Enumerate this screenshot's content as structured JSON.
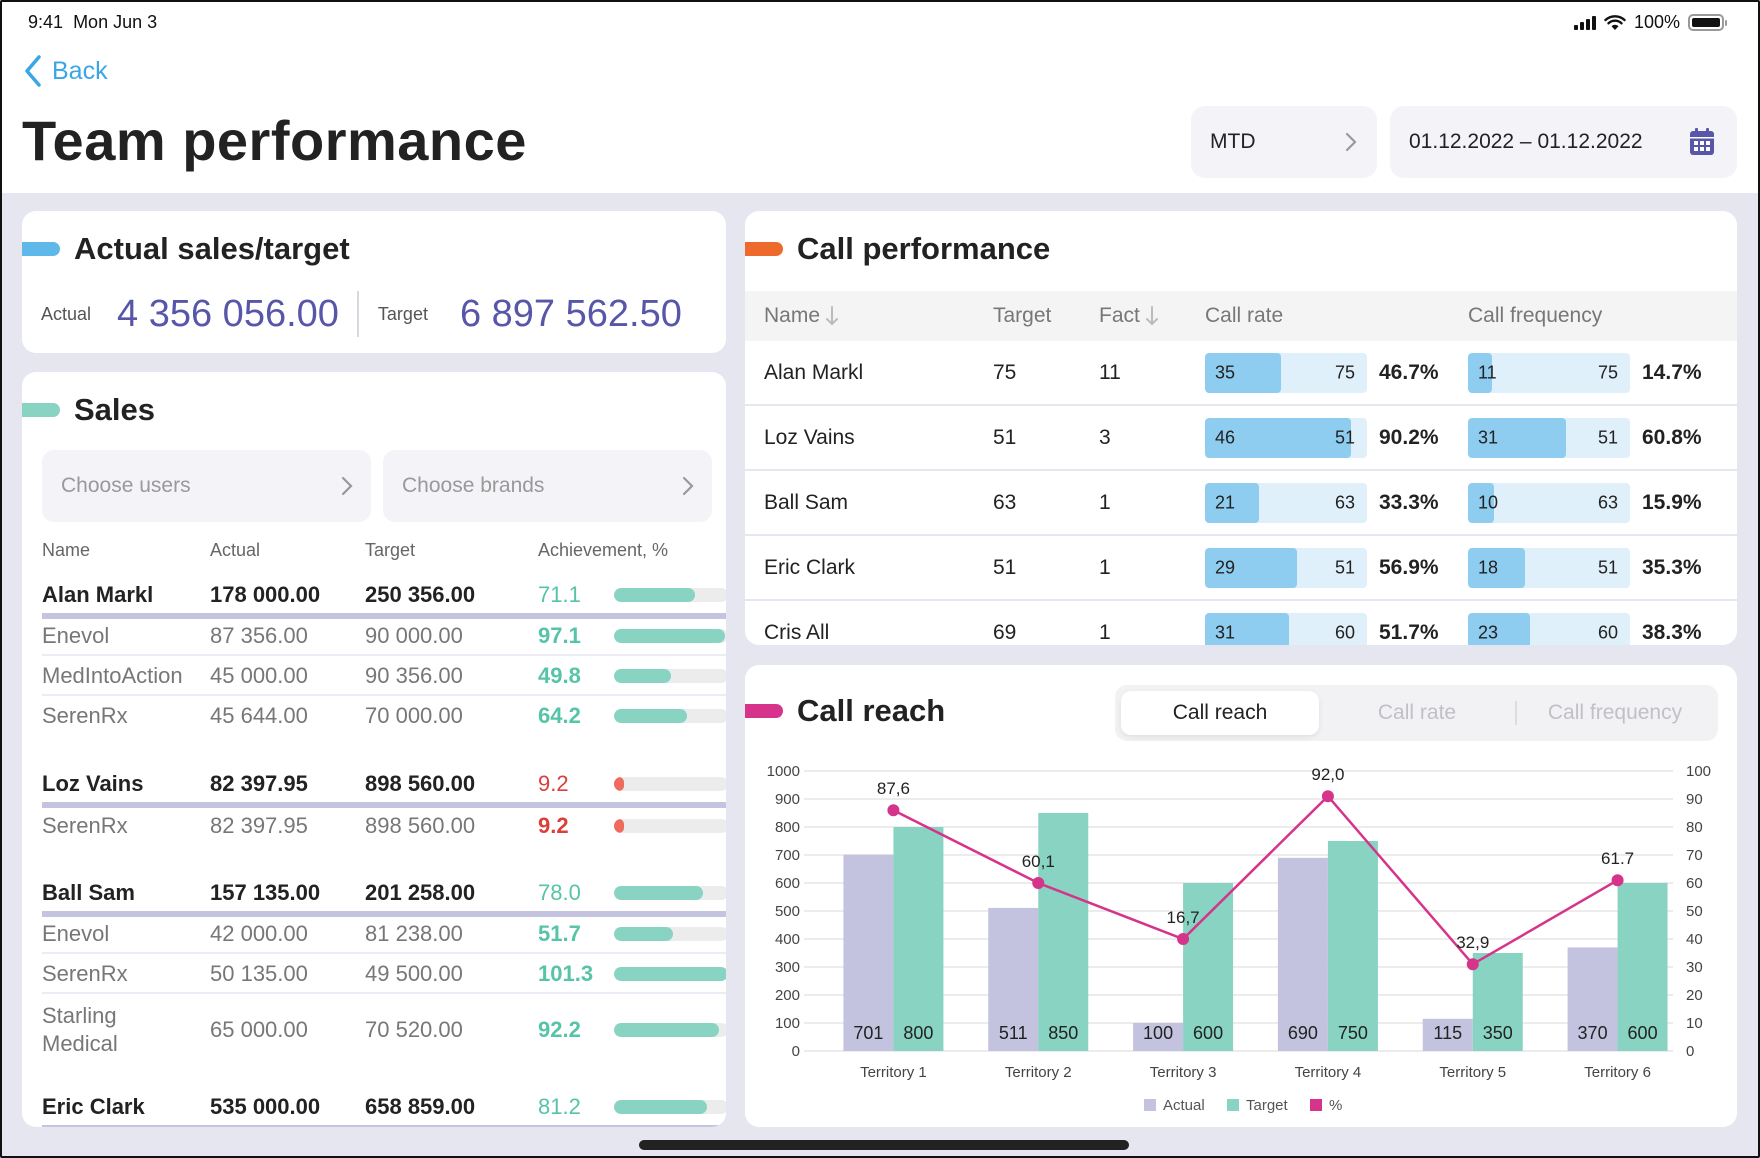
{
  "status_bar": {
    "time": "9:41",
    "date": "Mon Jun 3",
    "battery": "100%"
  },
  "nav": {
    "back_label": "Back"
  },
  "header": {
    "title": "Team performance",
    "period": "MTD",
    "date_range": "01.12.2022 – 01.12.2022"
  },
  "actual_sales": {
    "title": "Actual sales/target",
    "accent": "#5fb8ea",
    "actual_label": "Actual",
    "actual_value": "4 356 056.00",
    "target_label": "Target",
    "target_value": "6 897 562.50"
  },
  "sales": {
    "title": "Sales",
    "accent": "#88d3c2",
    "filters": {
      "users_placeholder": "Choose users",
      "brands_placeholder": "Choose brands"
    },
    "columns": [
      "Name",
      "Actual",
      "Target",
      "Achievement, %"
    ],
    "rows": [
      {
        "type": "parent",
        "name": "Alan Markl",
        "actual": "178 000.00",
        "target": "250 356.00",
        "achievement": "71.1",
        "pct": 71.1,
        "status": "good"
      },
      {
        "type": "child",
        "name": "Enevol",
        "actual": "87 356.00",
        "target": "90 000.00",
        "achievement": "97.1",
        "pct": 97.1,
        "status": "good"
      },
      {
        "type": "child",
        "name": "MedIntoAction",
        "actual": "45 000.00",
        "target": "90 356.00",
        "achievement": "49.8",
        "pct": 49.8,
        "status": "good"
      },
      {
        "type": "child",
        "name": "SerenRx",
        "actual": "45 644.00",
        "target": "70 000.00",
        "achievement": "64.2",
        "pct": 64.2,
        "status": "good"
      },
      {
        "type": "parent",
        "name": "Loz Vains",
        "actual": "82 397.95",
        "target": "898 560.00",
        "achievement": "9.2",
        "pct": 9.2,
        "status": "bad"
      },
      {
        "type": "child",
        "name": "SerenRx",
        "actual": "82 397.95",
        "target": "898 560.00",
        "achievement": "9.2",
        "pct": 9.2,
        "status": "bad"
      },
      {
        "type": "parent",
        "name": "Ball Sam",
        "actual": "157 135.00",
        "target": "201 258.00",
        "achievement": "78.0",
        "pct": 78.0,
        "status": "good"
      },
      {
        "type": "child",
        "name": "Enevol",
        "actual": "42 000.00",
        "target": "81 238.00",
        "achievement": "51.7",
        "pct": 51.7,
        "status": "good"
      },
      {
        "type": "child",
        "name": "SerenRx",
        "actual": "50 135.00",
        "target": "49 500.00",
        "achievement": "101.3",
        "pct": 101.3,
        "status": "good"
      },
      {
        "type": "child",
        "name": "Starling Medical",
        "actual": "65 000.00",
        "target": "70 520.00",
        "achievement": "92.2",
        "pct": 92.2,
        "status": "good"
      },
      {
        "type": "parent",
        "name": "Eric Clark",
        "actual": "535 000.00",
        "target": "658 859.00",
        "achievement": "81.2",
        "pct": 81.2,
        "status": "good"
      }
    ],
    "colors": {
      "good": "#57c3a8",
      "good_bar": "#88d3c2",
      "bad": "#d9403a",
      "bad_bar": "#ee6b5e"
    }
  },
  "call_performance": {
    "title": "Call performance",
    "accent": "#ee6a2c",
    "columns": [
      "Name",
      "Target",
      "Fact",
      "Call rate",
      "Call frequency"
    ],
    "rows": [
      {
        "name": "Alan Markl",
        "target": "75",
        "fact": "11",
        "rate_value": 35,
        "rate_max": 75,
        "rate_pct": "46.7%",
        "freq_value": 11,
        "freq_max": 75,
        "freq_pct": "14.7%"
      },
      {
        "name": "Loz Vains",
        "target": "51",
        "fact": "3",
        "rate_value": 46,
        "rate_max": 51,
        "rate_pct": "90.2%",
        "freq_value": 31,
        "freq_max": 51,
        "freq_pct": "60.8%"
      },
      {
        "name": "Ball Sam",
        "target": "63",
        "fact": "1",
        "rate_value": 21,
        "rate_max": 63,
        "rate_pct": "33.3%",
        "freq_value": 10,
        "freq_max": 63,
        "freq_pct": "15.9%"
      },
      {
        "name": "Eric Clark",
        "target": "51",
        "fact": "1",
        "rate_value": 29,
        "rate_max": 51,
        "rate_pct": "56.9%",
        "freq_value": 18,
        "freq_max": 51,
        "freq_pct": "35.3%"
      },
      {
        "name": "Cris All",
        "target": "69",
        "fact": "1",
        "rate_value": 31,
        "rate_max": 60,
        "rate_pct": "51.7%",
        "freq_value": 23,
        "freq_max": 60,
        "freq_pct": "38.3%"
      }
    ]
  },
  "call_reach": {
    "title": "Call reach",
    "accent": "#d6338a",
    "tabs": [
      {
        "label": "Call reach",
        "active": true
      },
      {
        "label": "Call rate",
        "active": false
      },
      {
        "label": "Call frequency",
        "active": false
      }
    ]
  },
  "chart_data": {
    "type": "bar",
    "title": "Call reach",
    "categories": [
      "Territory 1",
      "Territory 2",
      "Territory 3",
      "Territory 4",
      "Territory 5",
      "Territory 6"
    ],
    "series": [
      {
        "name": "Actual",
        "type": "bar",
        "axis": "left",
        "color": "#c3c3df",
        "values": [
          701,
          511,
          100,
          690,
          115,
          370
        ]
      },
      {
        "name": "Target",
        "type": "bar",
        "axis": "left",
        "color": "#88d3c2",
        "values": [
          800,
          850,
          600,
          750,
          350,
          600
        ]
      },
      {
        "name": "%",
        "type": "line",
        "axis": "right",
        "color": "#d6338a",
        "values": [
          87.6,
          60.1,
          16.7,
          92.0,
          32.9,
          61.7
        ],
        "labels": [
          "87,6",
          "60,1",
          "16,7",
          "92,0",
          "32,9",
          "61.7"
        ],
        "plotted_values": [
          86,
          60,
          40,
          91,
          31,
          61
        ]
      }
    ],
    "y_left": {
      "min": 0,
      "max": 1000,
      "ticks": [
        0,
        100,
        200,
        300,
        400,
        500,
        600,
        700,
        800,
        900,
        1000
      ]
    },
    "y_right": {
      "min": 0,
      "max": 100,
      "ticks": [
        0,
        10,
        20,
        30,
        40,
        50,
        60,
        70,
        80,
        90,
        100
      ]
    },
    "xlabel": "",
    "ylabel": "",
    "grid": true,
    "legend": "bottom-center"
  }
}
